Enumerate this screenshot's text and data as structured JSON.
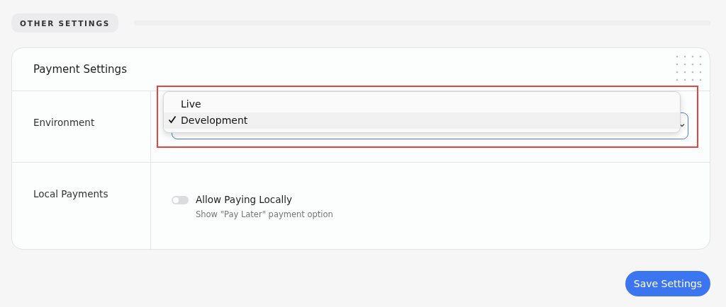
{
  "section": {
    "title": "OTHER SETTINGS"
  },
  "card": {
    "title": "Payment Settings",
    "rows": [
      {
        "kind": "select",
        "label": "Environment",
        "menu": {
          "options": [
            {
              "label": "Live",
              "selected": false
            },
            {
              "label": "Development",
              "selected": true
            }
          ]
        },
        "highlighted": true
      },
      {
        "kind": "toggle",
        "label": "Local Payments",
        "toggle": {
          "label": "Allow Paying Locally",
          "description": "Show \"Pay Later\" payment option",
          "on": false
        }
      }
    ]
  },
  "save_button": "Save Settings"
}
